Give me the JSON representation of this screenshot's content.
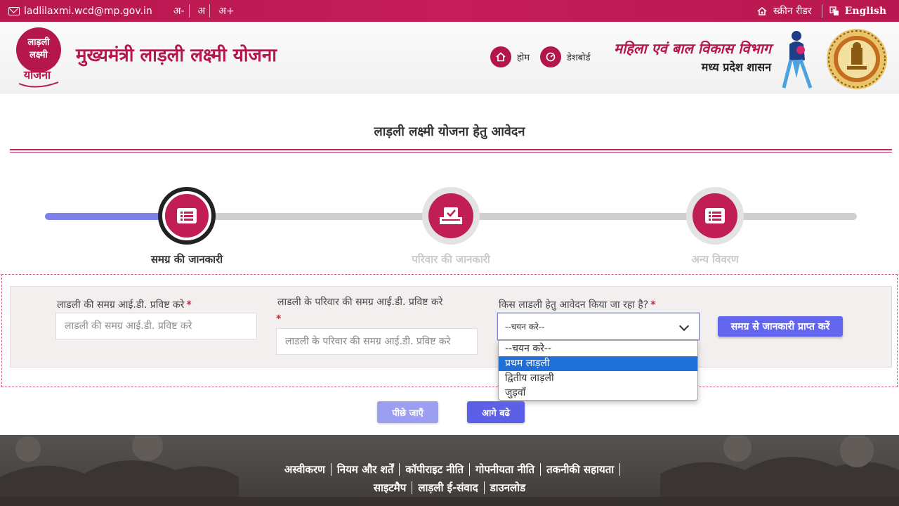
{
  "topbar": {
    "email": "ladlilaxmi.wcd@mp.gov.in",
    "font_controls": [
      "अ-",
      "अ",
      "अ+"
    ],
    "screen_reader": "स्क्रीन रीडर",
    "language": "English"
  },
  "header": {
    "logo_text": [
      "लाड़ली",
      "लक्ष्मी",
      "योजना"
    ],
    "site_title": "मुख्यमंत्री लाड़ली लक्ष्मी योजना",
    "home_label": "होम",
    "dashboard_label": "डेशबोर्ड",
    "dept_line1": "महिला एवं बाल विकास विभाग",
    "dept_line2": "मध्य प्रदेश शासन"
  },
  "page": {
    "title": "लाड़ली लक्ष्मी योजना हेतु आवेदन"
  },
  "stepper": {
    "progress_fraction": 0.17,
    "steps": [
      {
        "label": "समग्र की जानकारी",
        "state": "active"
      },
      {
        "label": "परिवार की जानकारी",
        "state": "inactive"
      },
      {
        "label": "अन्य विवरण",
        "state": "inactive"
      }
    ]
  },
  "form": {
    "ladli_id_label": "लाडली की समग्र आई.डी. प्रविष्ट करे",
    "ladli_id_placeholder": "लाडली की समग्र आई.डी. प्रविष्ट करे",
    "family_id_label": "लाडली के परिवार की समग्र आई.डी. प्रविष्ट करे",
    "family_id_placeholder": "लाडली के परिवार की समग्र आई.डी. प्रविष्ट करे",
    "which_ladli_label": "किस लाडली हेतु आवेदन किया जा रहा है?",
    "required_mark": "*",
    "select_value": "--चयन करे--",
    "options": [
      "--चयन करे--",
      "प्रथम लाड़ली",
      "द्वितीय लाड़ली",
      "जुड़वाँ"
    ],
    "highlighted_option": "प्रथम लाड़ली",
    "fetch_button": "समग्र से जानकारी प्राप्त करें"
  },
  "nav": {
    "back": "पीछे जाएँ",
    "next": "आगे बढे"
  },
  "footer": {
    "row1": [
      "अस्वीकरण",
      "नियम और शर्तें",
      "कॉपीराइट नीति",
      "गोपनीयता नीति",
      "तकनीकी सहायता"
    ],
    "row2": [
      "साइटमैप",
      "लाड़ली ई-संवाद",
      "डाउनलोड"
    ]
  },
  "colors": {
    "brand": "#c01e55",
    "button": "#5c5fe8",
    "progress": "#7e80e8"
  }
}
